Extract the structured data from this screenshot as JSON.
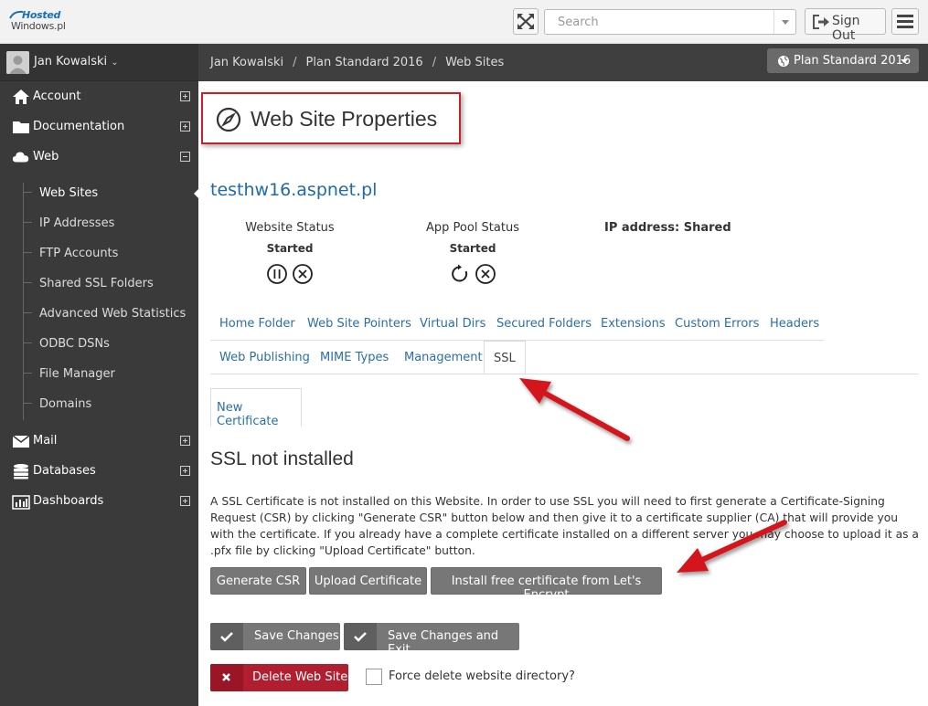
{
  "logo": {
    "line1": "Hosted",
    "line2": "Windows.pl"
  },
  "topbar": {
    "search_placeholder": "Search",
    "signout_label": "Sign Out"
  },
  "sidebar": {
    "user_name": "Jan Kowalski",
    "items": [
      {
        "label": "Account",
        "icon": "home-icon",
        "expanded": false
      },
      {
        "label": "Documentation",
        "icon": "folder-icon",
        "expanded": false
      },
      {
        "label": "Web",
        "icon": "cloud-icon",
        "expanded": true
      },
      {
        "label": "Mail",
        "icon": "envelope-icon",
        "expanded": false
      },
      {
        "label": "Databases",
        "icon": "database-icon",
        "expanded": false
      },
      {
        "label": "Dashboards",
        "icon": "chart-icon",
        "expanded": false
      }
    ],
    "web_subitems": [
      {
        "label": "Web Sites",
        "active": true
      },
      {
        "label": "IP Addresses",
        "active": false
      },
      {
        "label": "FTP Accounts",
        "active": false
      },
      {
        "label": "Shared SSL Folders",
        "active": false
      },
      {
        "label": "Advanced Web Statistics",
        "active": false
      },
      {
        "label": "ODBC DSNs",
        "active": false
      },
      {
        "label": "File Manager",
        "active": false
      },
      {
        "label": "Domains",
        "active": false
      }
    ]
  },
  "breadcrumb": {
    "items": [
      "Jan Kowalski",
      "Plan Standard 2016",
      "Web Sites"
    ],
    "separator": "/",
    "plan_button": "Plan Standard 2016"
  },
  "page": {
    "title": "Web Site Properties",
    "site_name": "testhw16.aspnet.pl",
    "website_status_label": "Website Status",
    "website_status_value": "Started",
    "app_pool_status_label": "App Pool Status",
    "app_pool_status_value": "Started",
    "ip_address": "IP address: Shared"
  },
  "tabs": {
    "row1": [
      "Home Folder",
      "Web Site Pointers",
      "Virtual Dirs",
      "Secured Folders",
      "Extensions",
      "Custom Errors",
      "Headers"
    ],
    "row2": [
      "Web Publishing",
      "MIME Types",
      "Management",
      "SSL"
    ],
    "active": "SSL",
    "subtab": "New Certificate"
  },
  "ssl": {
    "heading": "SSL not installed",
    "description": "A SSL Certificate is not installed on this Website. In order to use SSL you will need to first generate a Certificate-Signing Request (CSR) by clicking \"Generate CSR\" button below and then give it to a certificate supplier (CA) that will provide you with the certificate. If you already have a complete certificate installed on a different server you may choose to upload it as a .pfx file by clicking \"Upload Certificate\" button.",
    "generate_csr": "Generate CSR",
    "upload_certificate": "Upload Certificate",
    "install_free": "Install free certificate from Let's Encrypt"
  },
  "actions": {
    "save": "Save Changes",
    "save_exit": "Save Changes and Exit",
    "delete": "Delete Web Site",
    "force_delete": "Force delete website directory?"
  },
  "colors": {
    "accent_link": "#1f6aa8",
    "sidebar_bg": "#3a3a3a",
    "delete_red": "#b11e2f",
    "highlight_red": "#c8202a"
  }
}
